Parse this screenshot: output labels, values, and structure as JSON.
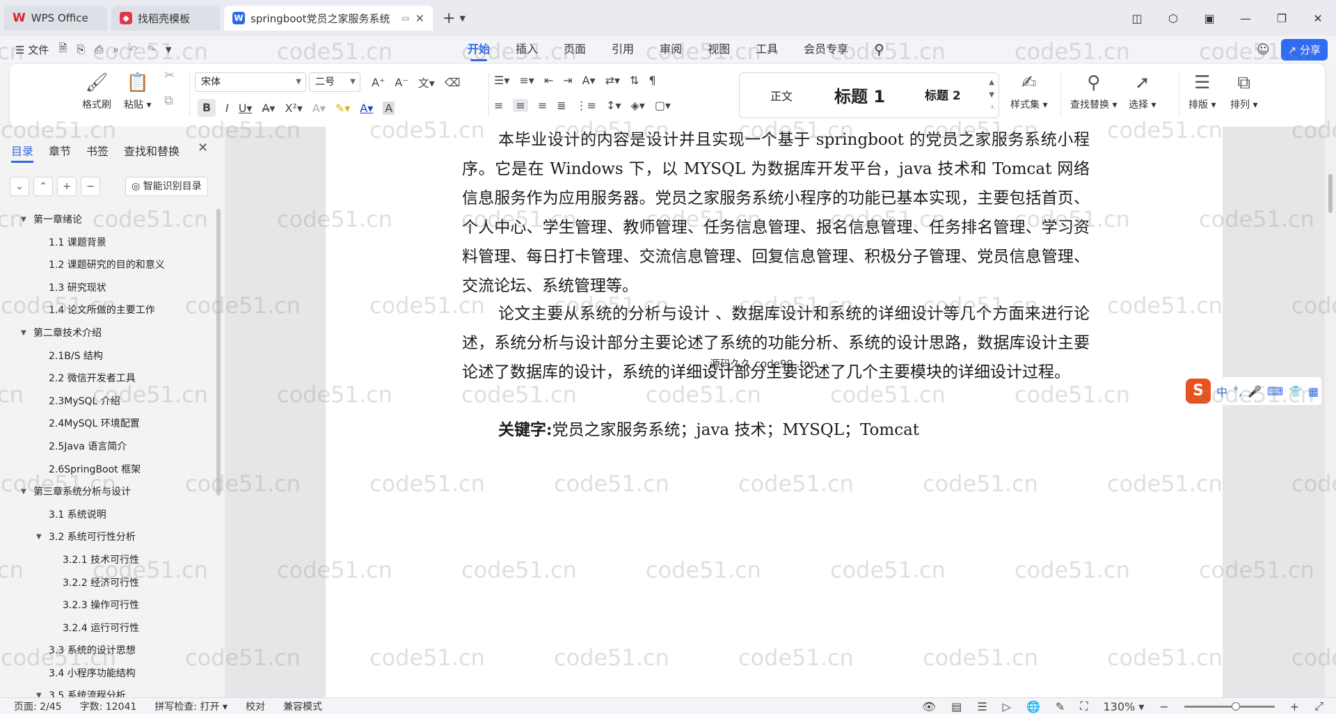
{
  "titlebar": {
    "tabs": [
      {
        "label": "WPS Office",
        "icon": "wps-logo-icon"
      },
      {
        "label": "找稻壳模板",
        "icon": "docer-logo-icon"
      },
      {
        "label": "springboot党员之家服务系统",
        "icon": "writer-doc-icon"
      }
    ]
  },
  "menu": {
    "file_label": "文件",
    "tabs": [
      "开始",
      "插入",
      "页面",
      "引用",
      "审阅",
      "视图",
      "工具",
      "会员专享"
    ],
    "share_label": "分享"
  },
  "ribbon": {
    "format_painter": "格式刷",
    "paste": "粘贴",
    "font_name": "宋体",
    "font_size": "二号",
    "styles": {
      "normal": "正文",
      "heading1": "标题 1",
      "heading2": "标题 2"
    },
    "style_set": "样式集",
    "find_replace": "查找替换",
    "select": "选择",
    "layout": "排版",
    "arrange": "排列"
  },
  "sidebar": {
    "tabs": [
      "目录",
      "章节",
      "书签",
      "查找和替换"
    ],
    "smart_toc": "智能识别目录",
    "toc": [
      {
        "label": "第一章绪论",
        "level": 1,
        "expanded": true
      },
      {
        "label": "1.1 课题背景",
        "level": 2
      },
      {
        "label": "1.2 课题研究的目的和意义",
        "level": 2
      },
      {
        "label": "1.3  研究现状",
        "level": 2
      },
      {
        "label": "1.4 论文所做的主要工作",
        "level": 2
      },
      {
        "label": "第二章技术介绍",
        "level": 1,
        "expanded": true
      },
      {
        "label": "2.1B/S 结构",
        "level": 2
      },
      {
        "label": "2.2 微信开发者工具",
        "level": 2
      },
      {
        "label": "2.3MySQL 介绍",
        "level": 2
      },
      {
        "label": "2.4MySQL 环境配置",
        "level": 2
      },
      {
        "label": "2.5Java 语言简介",
        "level": 2
      },
      {
        "label": "2.6SpringBoot 框架",
        "level": 2
      },
      {
        "label": "第三章系统分析与设计",
        "level": 1,
        "expanded": true
      },
      {
        "label": "3.1 系统说明",
        "level": 2
      },
      {
        "label": "3.2 系统可行性分析",
        "level": 2,
        "expanded": true
      },
      {
        "label": "3.2.1  技术可行性",
        "level": 3
      },
      {
        "label": "3.2.2  经济可行性",
        "level": 3
      },
      {
        "label": "3.2.3 操作可行性",
        "level": 3
      },
      {
        "label": "3.2.4 运行可行性",
        "level": 3
      },
      {
        "label": "3.3 系统的设计思想",
        "level": 2
      },
      {
        "label": "3.4 小程序功能结构",
        "level": 2
      },
      {
        "label": "3.5 系统流程分析",
        "level": 2,
        "expanded": true
      }
    ]
  },
  "document": {
    "paragraphs": [
      "本毕业设计的内容是设计并且实现一个基于 springboot 的党员之家服务系统小程序。它是在 Windows 下，以 MYSQL 为数据库开发平台，java 技术和 Tomcat 网络信息服务作为应用服务器。党员之家服务系统小程序的功能已基本实现，主要包括首页、个人中心、学生管理、教师管理、任务信息管理、报名信息管理、任务排名管理、学习资料管理、每日打卡管理、交流信息管理、回复信息管理、积极分子管理、党员信息管理、交流论坛、系统管理等。",
      "论文主要从系统的分析与设计 、数据库设计和系统的详细设计等几个方面来进行论述，系统分析与设计部分主要论述了系统的功能分析、系统的设计思路，数据库设计主要论述了数据库的设计，系统的详细设计部分主要论述了几个主要模块的详细设计过程。"
    ],
    "keywords_label": "关键字:",
    "keywords_text": "党员之家服务系统；java 技术；MYSQL；Tomcat",
    "source_mark": "源码久久 code99 .top"
  },
  "watermark_text": "code51.cn",
  "ime": {
    "lang": "中"
  },
  "status": {
    "page": "页面: 2/45",
    "words": "字数: 12041",
    "spell": "拼写检查: 打开",
    "proof": "校对",
    "compat": "兼容模式",
    "zoom": "130%"
  },
  "colors": {
    "accent": "#2f68e6",
    "wps_red": "#d22222"
  }
}
